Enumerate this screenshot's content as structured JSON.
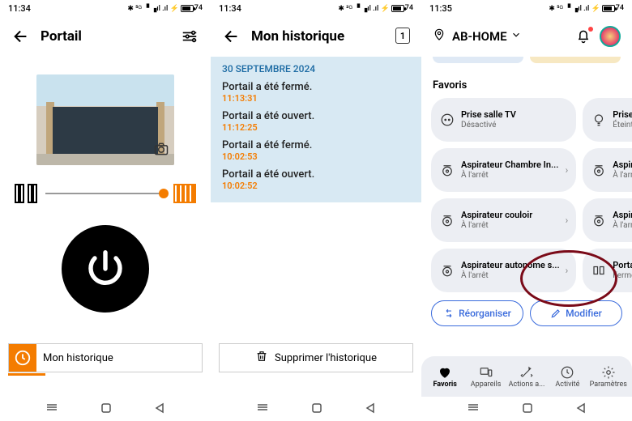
{
  "screen1": {
    "status_time": "11:34",
    "battery_pct": "74",
    "title": "Portail",
    "history_label": "Mon historique"
  },
  "screen2": {
    "status_time": "11:34",
    "battery_pct": "74",
    "title": "Mon historique",
    "page_indicator": "1",
    "date": "30 SEPTEMBRE 2024",
    "events": [
      {
        "text": "Portail a été fermé.",
        "time": "11:13:31"
      },
      {
        "text": "Portail a été ouvert.",
        "time": "11:12:25"
      },
      {
        "text": "Portail a été fermé.",
        "time": "10:02:53"
      },
      {
        "text": "Portail a été ouvert.",
        "time": "10:02:52"
      }
    ],
    "delete_label": "Supprimer l'historique"
  },
  "screen3": {
    "status_time": "11:35",
    "battery_pct": "74",
    "location": "AB-HOME",
    "favorites_label": "Favoris",
    "tiles": [
      {
        "name": "Prise salle TV",
        "state": "Désactivé",
        "icon": "outlet"
      },
      {
        "name": "Prise Cuisine",
        "state": "Éteint",
        "icon": "bulb"
      },
      {
        "name": "Aspirateur Chambre In...",
        "state": "À l'arrêt",
        "icon": "vacuum"
      },
      {
        "name": "Aspirateur salon",
        "state": "À l'arrêt",
        "icon": "vacuum"
      },
      {
        "name": "Aspirateur couloir",
        "state": "À l'arrêt",
        "icon": "vacuum"
      },
      {
        "name": "Aspirateur Salle Tv",
        "state": "À l'arrêt",
        "icon": "vacuum"
      },
      {
        "name": "Aspirateur autonome s...",
        "state": "À l'arrêt",
        "icon": "vacuum"
      },
      {
        "name": "Portail",
        "state": "Fermé",
        "icon": "gate"
      }
    ],
    "reorganize": "Réorganiser",
    "modify": "Modifier",
    "tabs": [
      {
        "label": "Favoris",
        "icon": "heart",
        "active": true
      },
      {
        "label": "Appareils",
        "icon": "devices"
      },
      {
        "label": "Actions a...",
        "icon": "wand"
      },
      {
        "label": "Activité",
        "icon": "clock"
      },
      {
        "label": "Paramètres",
        "icon": "gear"
      }
    ]
  }
}
